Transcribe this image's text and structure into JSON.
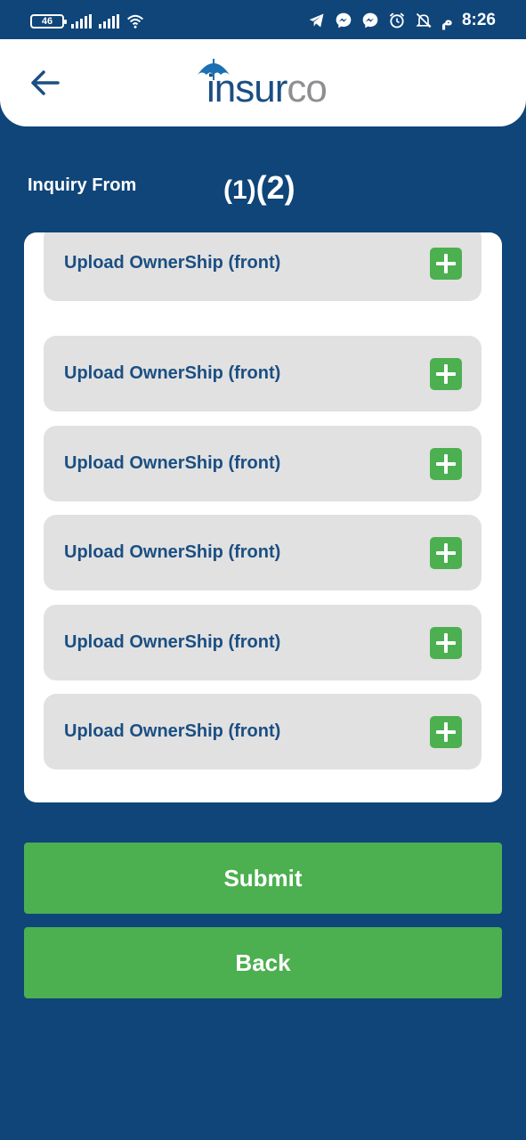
{
  "status_bar": {
    "battery": "46",
    "right_text": "م",
    "time": "8:26",
    "icons": [
      "signal-icon",
      "signal-icon",
      "wifi-icon",
      "telegram-icon",
      "messenger-icon",
      "messenger-icon",
      "alarm-icon",
      "mute-icon"
    ]
  },
  "header": {
    "back_icon": "arrow-left-icon",
    "logo_part1": "insur",
    "logo_part2": "co"
  },
  "inquiry": {
    "label": "Inquiry From",
    "step_1": "(1)",
    "step_2": "(2)"
  },
  "uploads": [
    {
      "label": "Upload OwnerShip (front)"
    },
    {
      "label": "Upload OwnerShip (front)"
    },
    {
      "label": "Upload OwnerShip (front)"
    },
    {
      "label": "Upload OwnerShip (front)"
    },
    {
      "label": "Upload OwnerShip (front)"
    },
    {
      "label": "Upload OwnerShip (front)"
    }
  ],
  "actions": {
    "submit_label": "Submit",
    "back_label": "Back"
  },
  "colors": {
    "background": "#0f4579",
    "accent_green": "#4caf50",
    "brand_blue": "#1b4f82",
    "row_gray": "#e1e1e1"
  }
}
